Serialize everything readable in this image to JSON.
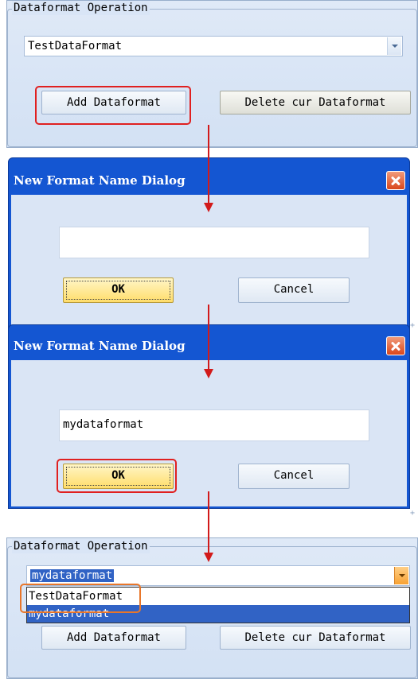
{
  "panel1": {
    "group_title": "Dataformat Operation",
    "combo_value": "TestDataFormat",
    "add_button": "Add Dataformat",
    "delete_button": "Delete cur Dataformat"
  },
  "dialog1": {
    "title": "New Format Name Dialog",
    "input_value": "",
    "ok_button": "OK",
    "cancel_button": "Cancel"
  },
  "dialog2": {
    "title": "New Format Name Dialog",
    "input_value": "mydataformat",
    "ok_button": "OK",
    "cancel_button": "Cancel"
  },
  "panel2": {
    "group_title": "Dataformat Operation",
    "combo_value": "mydataformat",
    "dropdown_items": [
      "TestDataFormat",
      "mydataformat"
    ],
    "add_button": "Add Dataformat",
    "delete_button": "Delete cur Dataformat"
  },
  "colors": {
    "annotation_red": "#d21a1a",
    "annotation_orange": "#e8762a",
    "dialog_title_bar": "#1456d2",
    "selection": "#3163c5"
  }
}
